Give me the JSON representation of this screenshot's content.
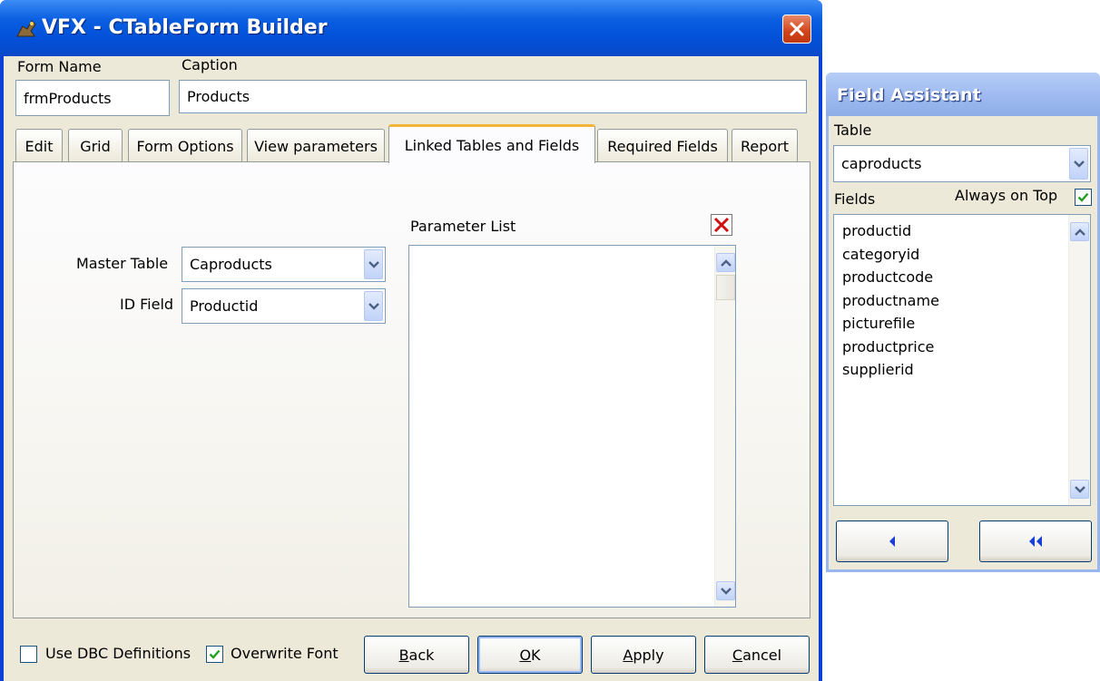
{
  "main_window": {
    "title": "VFX - CTableForm Builder",
    "form_name_label": "Form Name",
    "form_name_value": "frmProducts",
    "caption_label": "Caption",
    "caption_value": "Products",
    "tabs": [
      {
        "label": "Edit",
        "active": false
      },
      {
        "label": "Grid",
        "active": false
      },
      {
        "label": "Form Options",
        "active": false
      },
      {
        "label": "View parameters",
        "active": false
      },
      {
        "label": "Linked Tables and Fields",
        "active": true
      },
      {
        "label": "Required Fields",
        "active": false
      },
      {
        "label": "Report",
        "active": false
      }
    ],
    "master_table_label": "Master Table",
    "master_table_value": "Caproducts",
    "id_field_label": "ID Field",
    "id_field_value": "Productid",
    "parameter_list_label": "Parameter List",
    "use_dbc_label": "Use DBC Definitions",
    "use_dbc_checked": false,
    "overwrite_font_label": "Overwrite Font",
    "overwrite_font_checked": true,
    "buttons": {
      "back": {
        "hotkey": "B",
        "rest": "ack"
      },
      "ok": {
        "hotkey": "O",
        "rest": "K"
      },
      "apply": {
        "hotkey": "A",
        "rest": "pply"
      },
      "cancel": {
        "hotkey": "C",
        "rest": "ancel"
      }
    }
  },
  "field_assistant": {
    "title": "Field Assistant",
    "table_label": "Table",
    "table_value": "caproducts",
    "fields_label": "Fields",
    "always_on_top_label": "Always on Top",
    "always_on_top_checked": true,
    "fields": [
      "productid",
      "categoryid",
      "productcode",
      "productname",
      "picturefile",
      "productprice",
      "supplierid"
    ]
  },
  "colors": {
    "titlebar_blue": "#0a5ee0",
    "window_face": "#ece9d8",
    "active_tab_accent": "#f4b43a",
    "close_red": "#d3431a",
    "checkmark_green": "#21a121"
  },
  "icons": [
    "app-icon",
    "close-icon",
    "delete-x-icon",
    "chevron-down-icon",
    "chevron-up-icon",
    "arrow-left-icon",
    "double-arrow-left-icon",
    "checkmark-icon"
  ]
}
